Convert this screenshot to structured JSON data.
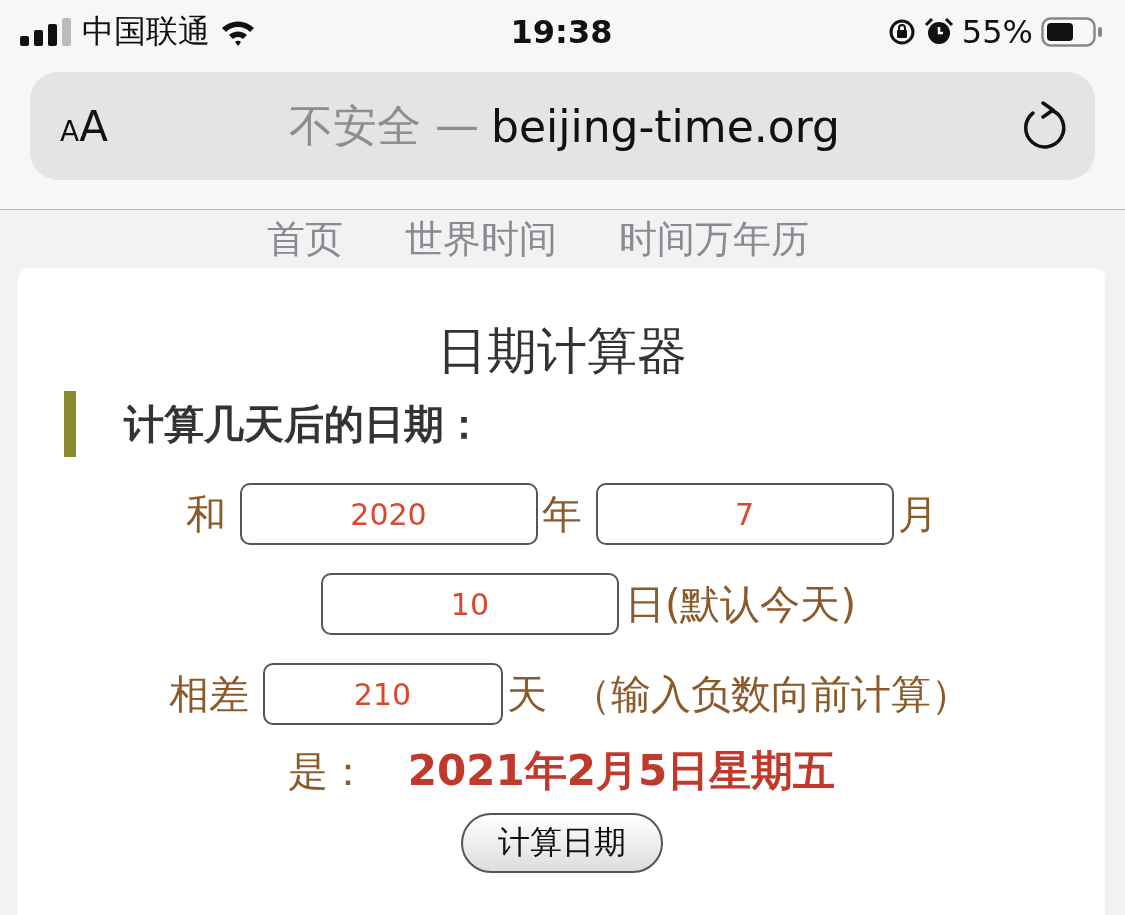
{
  "status_bar": {
    "carrier": "中国联通",
    "time": "19:38",
    "battery": "55%"
  },
  "address_bar": {
    "text_size_small": "A",
    "text_size_large": "A",
    "security": "不安全 —",
    "domain": "beijing-time.org"
  },
  "nav": [
    {
      "label": "首页"
    },
    {
      "label": "世界时间"
    },
    {
      "label": "时间万年历"
    }
  ],
  "card": {
    "title": "日期计算器",
    "section_heading": "计算几天后的日期：",
    "row_1": {
      "prefix": "和",
      "year": "2020",
      "year_unit": "年",
      "month": "7",
      "month_unit": "月"
    },
    "row_2": {
      "day": "10",
      "day_unit": "日(默认今天)"
    },
    "row_3": {
      "prefix": "相差",
      "days": "210",
      "days_unit": "天",
      "hint": "（输入负数向前计算）"
    },
    "result": {
      "label": "是：",
      "value": "2021年2月5日星期五"
    },
    "button": "计算日期"
  }
}
